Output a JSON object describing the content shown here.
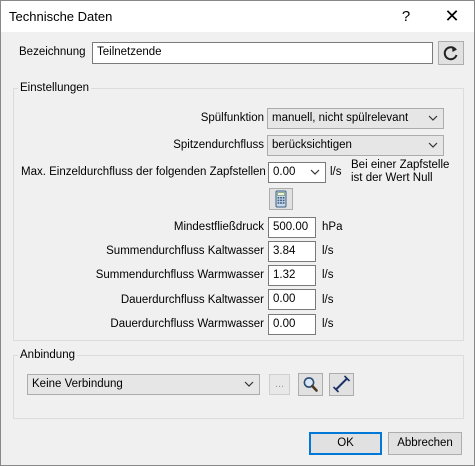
{
  "window": {
    "title": "Technische Daten",
    "help": "?",
    "close": "✕"
  },
  "bezeichnung": {
    "label": "Bezeichnung",
    "value": "Teilnetzende"
  },
  "einstellungen": {
    "title": "Einstellungen",
    "spuelfunktion_label": "Spülfunktion",
    "spuelfunktion_value": "manuell, nicht spülrelevant",
    "spitzendurchfluss_label": "Spitzendurchfluss",
    "spitzendurchfluss_value": "berücksichtigen",
    "max_label": "Max. Einzeldurchfluss der folgenden Zapfstellen",
    "max_value": "0.00",
    "max_unit": "l/s",
    "max_note_1": "Bei einer Zapfstelle",
    "max_note_2": "ist der Wert Null",
    "fields": [
      {
        "label": "Mindestfließdruck",
        "value": "500.00",
        "unit": "hPa"
      },
      {
        "label": "Summendurchfluss Kaltwasser",
        "value": "3.84",
        "unit": "l/s"
      },
      {
        "label": "Summendurchfluss Warmwasser",
        "value": "1.32",
        "unit": "l/s"
      },
      {
        "label": "Dauerdurchfluss Kaltwasser",
        "value": "0.00",
        "unit": "l/s"
      },
      {
        "label": "Dauerdurchfluss Warmwasser",
        "value": "0.00",
        "unit": "l/s"
      }
    ]
  },
  "anbindung": {
    "title": "Anbindung",
    "value": "Keine Verbindung",
    "ellipsis": "..."
  },
  "footer": {
    "ok": "OK",
    "cancel": "Abbrechen"
  },
  "colors": {
    "accent": "#0078d7",
    "dialog_bg": "#f0f0f0"
  }
}
